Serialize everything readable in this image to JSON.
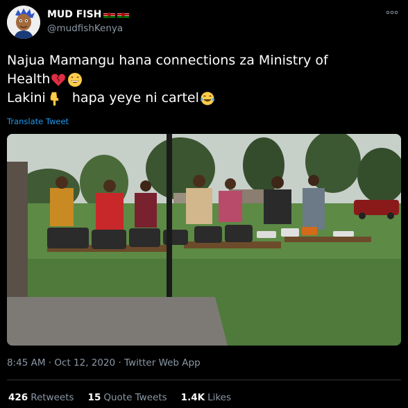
{
  "author": {
    "display_name": "MUD FISH",
    "handle": "@mudfishKenya",
    "avatar_icon": "cartoon-avatar",
    "flags": [
      "kenya-flag",
      "kenya-flag"
    ]
  },
  "more_icon": "more-dots-icon",
  "tweet": {
    "line1": "Najua Mamangu hana connections za Ministry of",
    "line2": "Health",
    "line2_emojis": [
      "broken-heart-emoji",
      "grinning-emoji"
    ],
    "line3_a": "Lakini",
    "line3_emoji_a": "pointing-down-emoji",
    "line3_b": "hapa yeye ni cartel",
    "line3_emoji_b": "tears-of-joy-emoji",
    "translate": "Translate Tweet"
  },
  "photo": {
    "description_icon": "outdoor-food-photo"
  },
  "meta": {
    "time": "8:45 AM",
    "sep1": "·",
    "date": "Oct 12, 2020",
    "sep2": "·",
    "source": "Twitter Web App"
  },
  "stats": {
    "retweets_count": "426",
    "retweets_label": "Retweets",
    "quotes_count": "15",
    "quotes_label": "Quote Tweets",
    "likes_count": "1.4K",
    "likes_label": "Likes"
  },
  "colors": {
    "background": "#000000",
    "link": "#1d9bf0",
    "muted": "#8b98a5"
  }
}
